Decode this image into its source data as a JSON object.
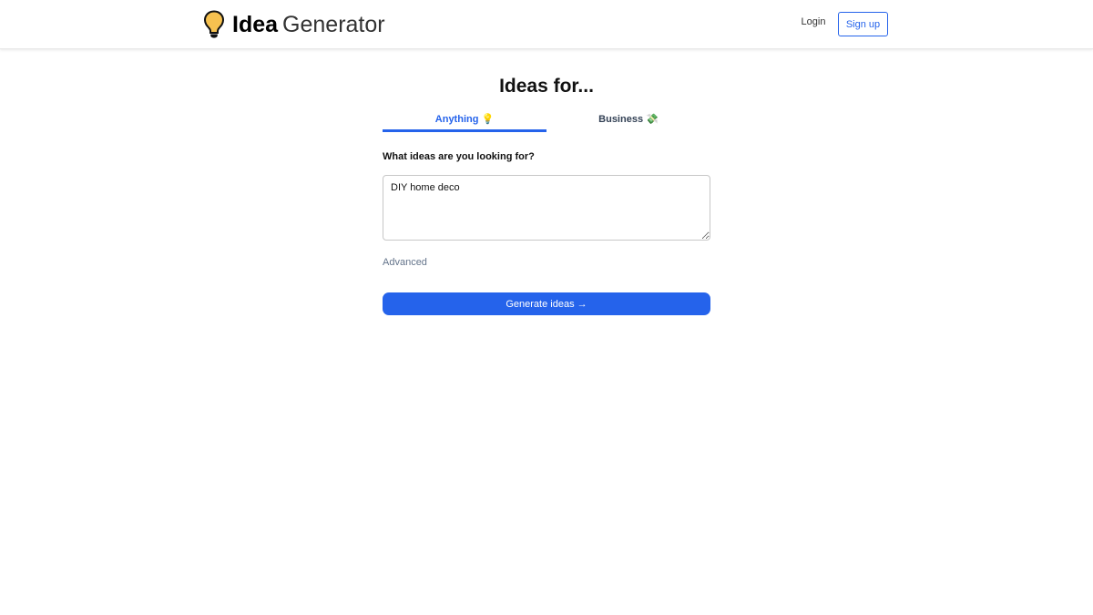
{
  "header": {
    "logo_icon": "lightbulb-icon",
    "logo_bold": "Idea",
    "logo_light": "Generator",
    "login_label": "Login",
    "signup_label": "Sign up"
  },
  "main": {
    "title": "Ideas for...",
    "tabs": [
      {
        "label": "Anything",
        "emoji": "💡",
        "active": true
      },
      {
        "label": "Business",
        "emoji": "💸",
        "active": false
      }
    ],
    "field_label": "What ideas are you looking for?",
    "input_value": "DIY home deco",
    "advanced_label": "Advanced",
    "generate_label": "Generate ideas →"
  },
  "colors": {
    "accent": "#2563eb",
    "bulb": "#f6c150"
  }
}
